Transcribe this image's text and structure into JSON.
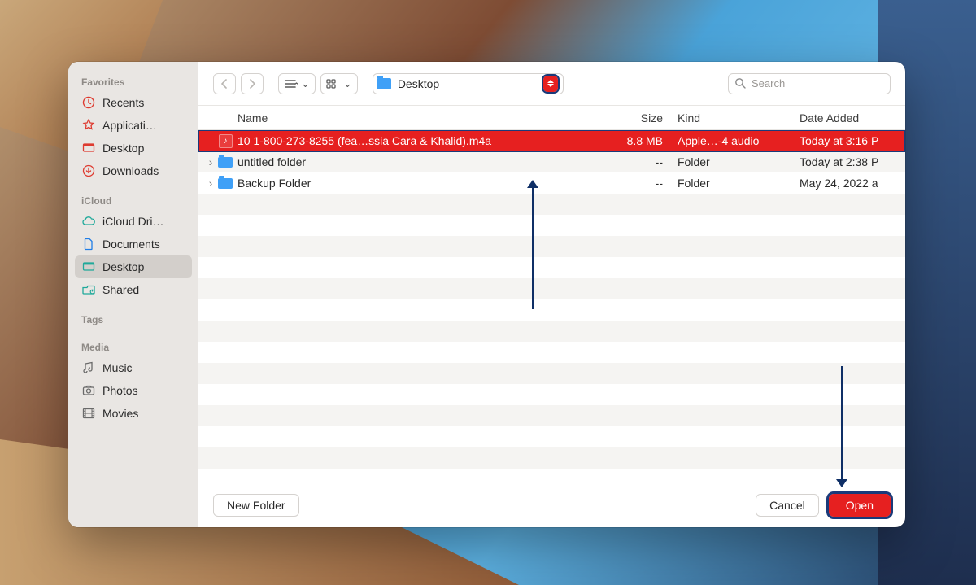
{
  "sidebar": {
    "sections": [
      {
        "header": "Favorites",
        "items": [
          {
            "label": "Recents",
            "icon": "clock-icon",
            "color": "red"
          },
          {
            "label": "Applicati…",
            "icon": "apps-icon",
            "color": "red"
          },
          {
            "label": "Desktop",
            "icon": "desktop-icon",
            "color": "red"
          },
          {
            "label": "Downloads",
            "icon": "download-icon",
            "color": "red"
          }
        ]
      },
      {
        "header": "iCloud",
        "items": [
          {
            "label": "iCloud Dri…",
            "icon": "cloud-icon",
            "color": "teal"
          },
          {
            "label": "Documents",
            "icon": "document-icon",
            "color": "blue"
          },
          {
            "label": "Desktop",
            "icon": "desktop-teal-icon",
            "color": "teal",
            "selected": true
          },
          {
            "label": "Shared",
            "icon": "shared-icon",
            "color": "teal"
          }
        ]
      },
      {
        "header": "Tags",
        "items": []
      },
      {
        "header": "Media",
        "items": [
          {
            "label": "Music",
            "icon": "music-note-icon",
            "color": "gray"
          },
          {
            "label": "Photos",
            "icon": "camera-icon",
            "color": "gray"
          },
          {
            "label": "Movies",
            "icon": "film-icon",
            "color": "gray"
          }
        ]
      }
    ]
  },
  "toolbar": {
    "location": "Desktop",
    "search_placeholder": "Search"
  },
  "columns": {
    "name": "Name",
    "size": "Size",
    "kind": "Kind",
    "date": "Date Added"
  },
  "files": [
    {
      "name": "10 1-800-273-8255 (fea…ssia Cara & Khalid).m4a",
      "size": "8.8 MB",
      "kind": "Apple…-4 audio",
      "date": "Today at 3:16 P",
      "type": "audio",
      "selected": true
    },
    {
      "name": "untitled folder",
      "size": "--",
      "kind": "Folder",
      "date": "Today at 2:38 P",
      "type": "folder",
      "expandable": true
    },
    {
      "name": "Backup Folder",
      "size": "--",
      "kind": "Folder",
      "date": "May 24, 2022 a",
      "type": "folder",
      "expandable": true
    }
  ],
  "footer": {
    "new_folder": "New Folder",
    "cancel": "Cancel",
    "open": "Open"
  }
}
